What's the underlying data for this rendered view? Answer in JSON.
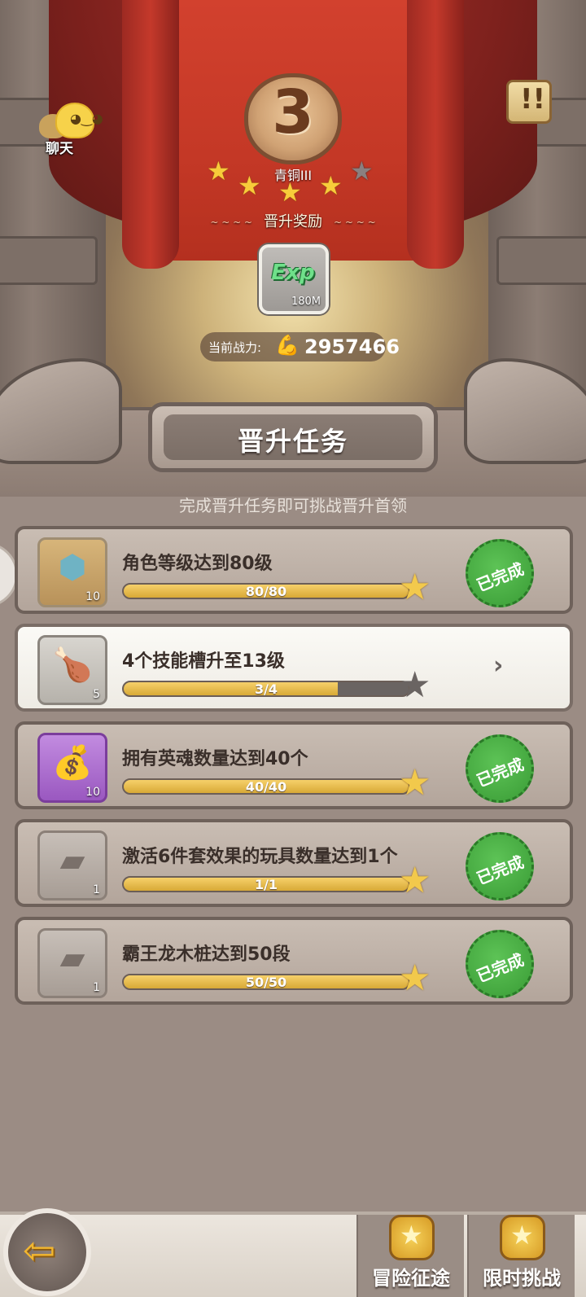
{
  "chat": {
    "label": "聊天",
    "icon": "chat-bubble-icon"
  },
  "notice": {
    "icon": "scroll-notice-icon"
  },
  "rank": {
    "number": "3",
    "name": "青铜III",
    "stars_filled": 4,
    "stars_total": 5
  },
  "reward": {
    "title": "晋升奖励",
    "item_label": "Exp",
    "item_count": "180M",
    "icon": "exp-icon"
  },
  "power": {
    "label": "当前战力:",
    "value": "2957466",
    "icon": "bicep-icon"
  },
  "section": {
    "title": "晋升任务",
    "hint": "完成晋升任务即可挑战晋升首领"
  },
  "tasks": [
    {
      "title": "角色等级达到80级",
      "progress_text": "80/80",
      "progress": 1.0,
      "count": "10",
      "done": true,
      "done_label": "已完成",
      "icon": "crystal-potion-icon"
    },
    {
      "title": "4个技能槽升至13级",
      "progress_text": "3/4",
      "progress": 0.75,
      "count": "5",
      "done": false,
      "icon": "roast-food-icon"
    },
    {
      "title": "拥有英魂数量达到40个",
      "progress_text": "40/40",
      "progress": 1.0,
      "count": "10",
      "done": true,
      "done_label": "已完成",
      "icon": "soul-bag-icon"
    },
    {
      "title": "激活6件套效果的玩具数量达到1个",
      "progress_text": "1/1",
      "progress": 1.0,
      "count": "1",
      "done": true,
      "done_label": "已完成",
      "icon": "stone-tablet-icon"
    },
    {
      "title": "霸王龙木桩达到50段",
      "progress_text": "50/50",
      "progress": 1.0,
      "count": "1",
      "done": true,
      "done_label": "已完成",
      "icon": "stone-tablet-icon"
    }
  ],
  "nav": {
    "back_icon": "back-arrow-icon",
    "tab1": "冒险征途",
    "tab2": "限时挑战"
  },
  "colors": {
    "accent_gold": "#f2c94c",
    "done_green": "#3a9c36",
    "curtain_red": "#c43826"
  }
}
